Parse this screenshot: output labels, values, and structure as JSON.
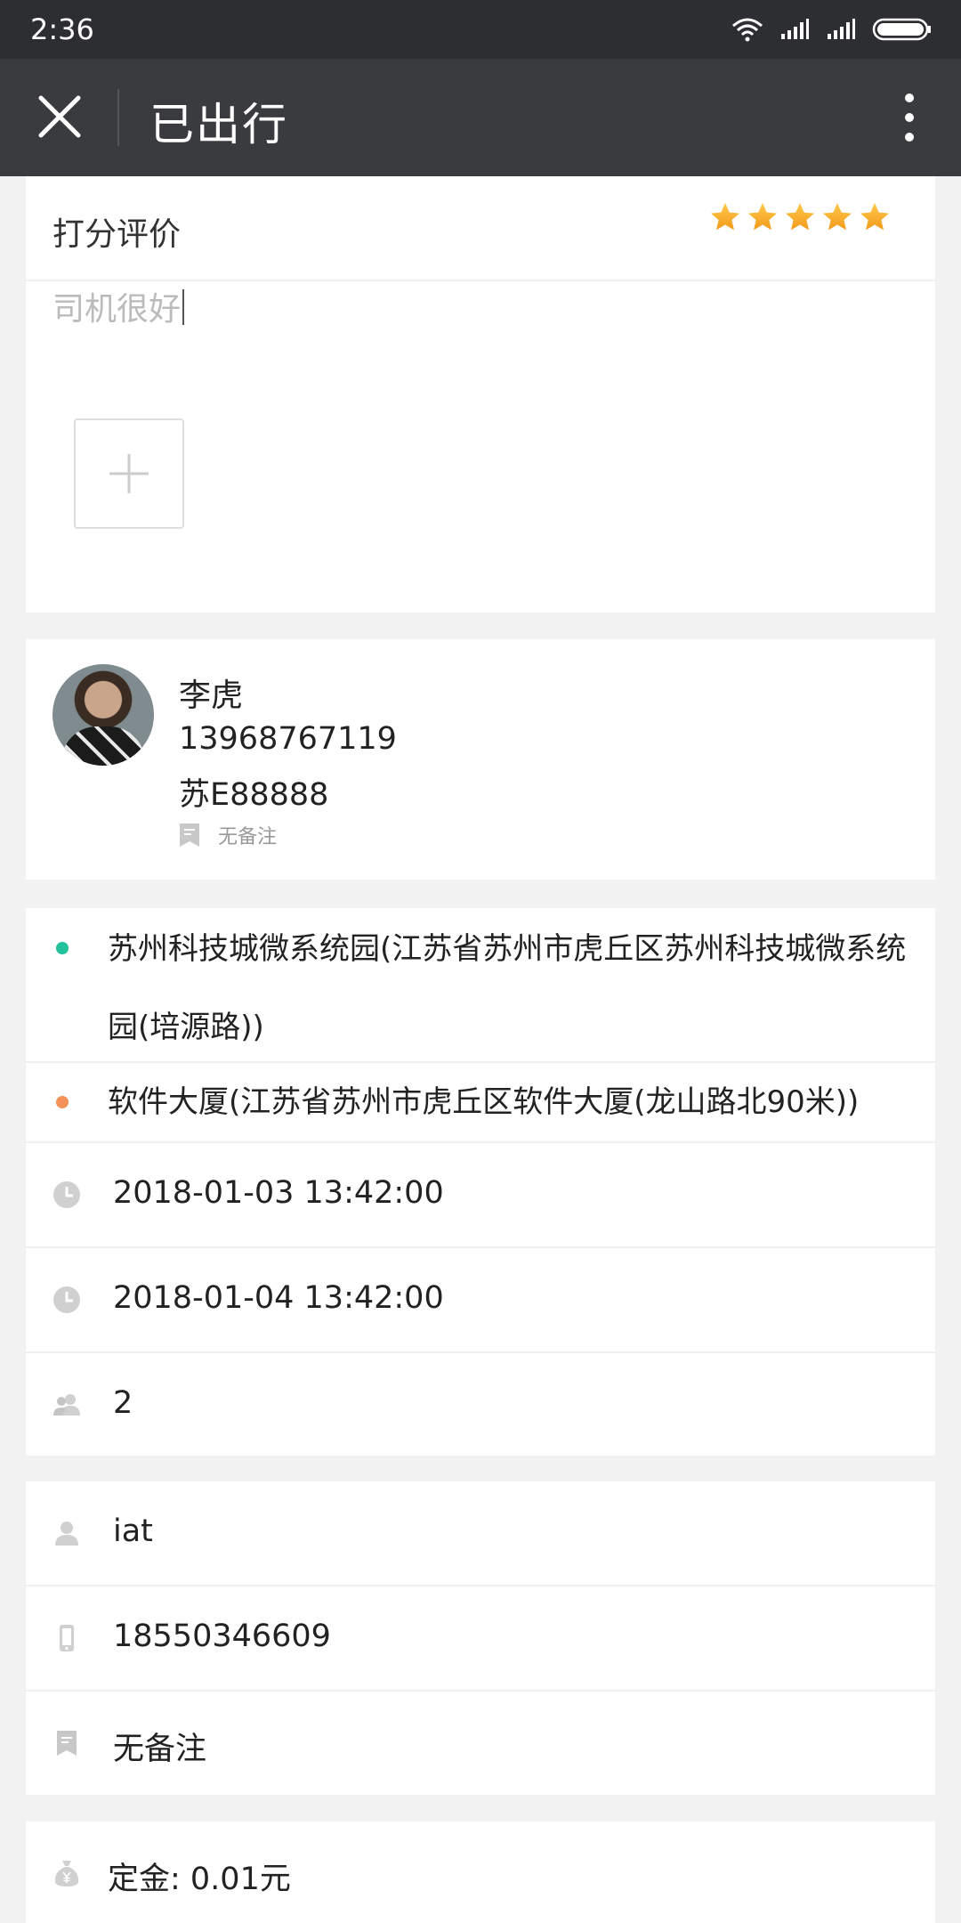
{
  "status_bar": {
    "time": "2:36"
  },
  "app_bar": {
    "title": "已出行"
  },
  "rating": {
    "label": "打分评价",
    "stars": 5,
    "max_stars": 5,
    "comment": "司机很好"
  },
  "driver": {
    "name": "李虎",
    "phone": "13968767119",
    "plate": "苏E88888",
    "note": "无备注"
  },
  "trip": {
    "start_address": "苏州科技城微系统园(江苏省苏州市虎丘区苏州科技城微系统园(培源路))",
    "end_address": "软件大厦(江苏省苏州市虎丘区软件大厦(龙山路北90米))",
    "depart_time": "2018-01-03 13:42:00",
    "return_time": "2018-01-04 13:42:00",
    "passengers": "2",
    "colors": {
      "start_dot": "#22c29c",
      "end_dot": "#f4925a"
    }
  },
  "passenger": {
    "name": "iat",
    "phone": "18550346609",
    "note": "无备注"
  },
  "deposit": {
    "text": "定金: 0.01元"
  },
  "icons": {
    "status": [
      "wifi-icon",
      "signal-icon",
      "signal-icon",
      "battery-icon"
    ],
    "trip": [
      "clock-icon",
      "clock-icon",
      "people-icon"
    ],
    "passenger": [
      "person-icon",
      "phone-icon",
      "note-icon"
    ],
    "deposit": "money-bag-icon"
  }
}
